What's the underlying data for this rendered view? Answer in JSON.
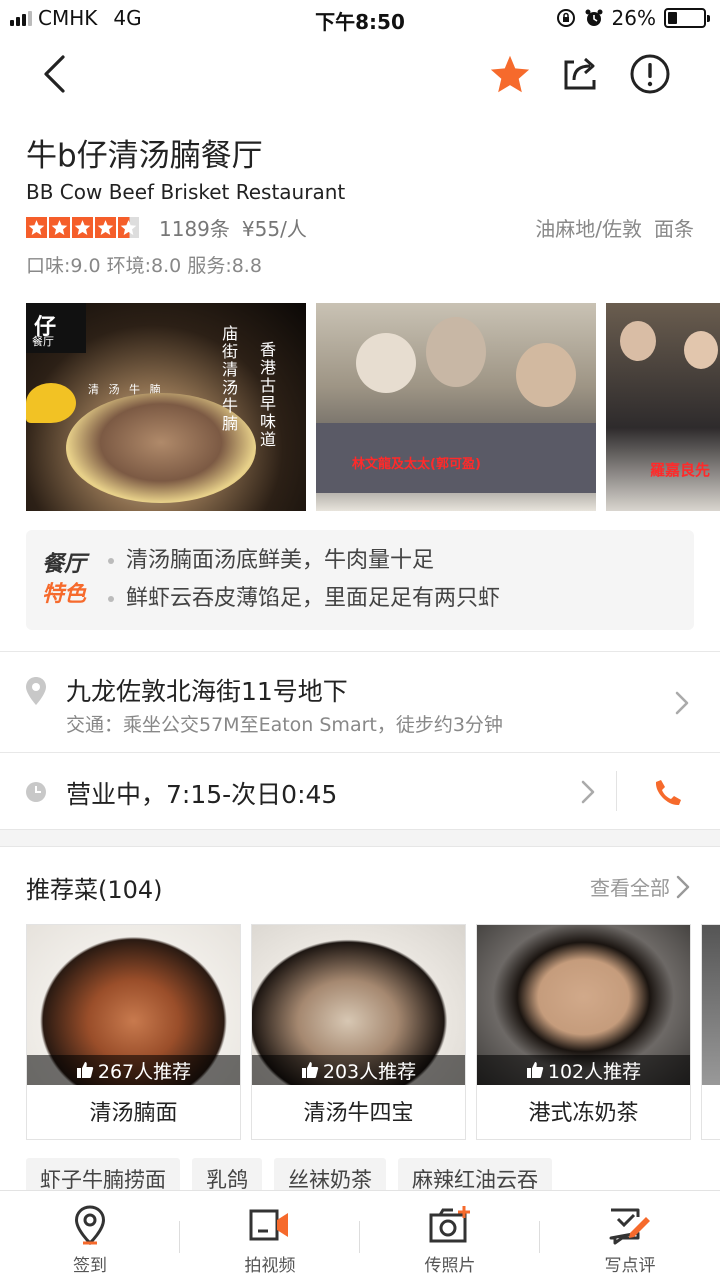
{
  "status": {
    "carrier": "CMHK",
    "network": "4G",
    "time": "下午8:50",
    "battery": "26%",
    "battery_level": 0.26
  },
  "nav": {
    "back_icon": "chevron-left-icon",
    "favorite_icon": "star-icon",
    "share_icon": "share-icon",
    "report_icon": "exclamation-icon",
    "accent": "#f66a2c"
  },
  "restaurant": {
    "name": "牛b仔清汤腩餐厅",
    "name_en": "BB Cow Beef Brisket Restaurant",
    "stars": 4.5,
    "reviews": "1189条",
    "price": "¥55/人",
    "area": "油麻地/佐敦",
    "category": "面条",
    "scores": "口味:9.0 环境:8.0 服务:8.8"
  },
  "photos": {
    "p1_text_a": "庙街清汤牛腩",
    "p1_text_b": "香港古早味道",
    "p1_top": "仔",
    "p1_top2": "餐厅",
    "p1_middle": "清 汤 牛 腩",
    "p2_caption": "林文龍及太太(郭可盈)",
    "p3_caption": "羅嘉良先"
  },
  "features": {
    "badge_line1": "餐厅",
    "badge_line2": "特色",
    "items": [
      "清汤腩面汤底鲜美，牛肉量十足",
      "鲜虾云吞皮薄馅足，里面足足有两只虾"
    ]
  },
  "address": {
    "main": "九龙佐敦北海街11号地下",
    "transit": "交通：乘坐公交57M至Eaton Smart，徒步约3分钟"
  },
  "hours": {
    "text": "营业中，7:15-次日0:45"
  },
  "recommended": {
    "title": "推荐菜(104)",
    "view_all": "查看全部",
    "dishes": [
      {
        "name": "清汤腩面",
        "likes": "267人推荐"
      },
      {
        "name": "清汤牛四宝",
        "likes": "203人推荐"
      },
      {
        "name": "港式冻奶茶",
        "likes": "102人推荐"
      }
    ],
    "tags": [
      "虾子牛腩捞面",
      "乳鸽",
      "丝袜奶茶",
      "麻辣红油云吞"
    ]
  },
  "tabbar": {
    "items": [
      {
        "label": "签到",
        "icon": "location-pin-icon"
      },
      {
        "label": "拍视频",
        "icon": "video-camera-icon"
      },
      {
        "label": "传照片",
        "icon": "camera-plus-icon"
      },
      {
        "label": "写点评",
        "icon": "write-review-icon"
      }
    ]
  }
}
